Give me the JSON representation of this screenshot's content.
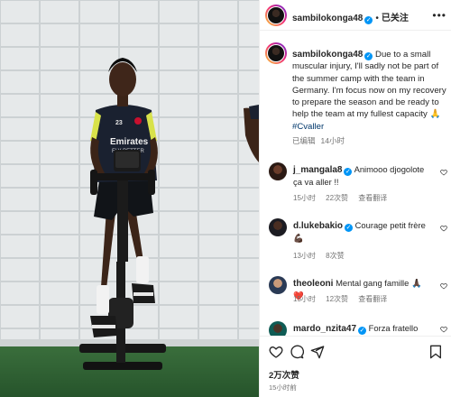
{
  "post": {
    "username": "sambilokonga48",
    "follow_sep": "•",
    "follow_label": "已关注",
    "more_label": "•••"
  },
  "caption": {
    "username": "sambilokonga48",
    "text": "Due to a small muscular injury, I'll sadly not be part of the summer camp with the team in Germany. I'm focus now on my recovery to prepare the season and be ready to help the team at my fullest capacity",
    "emoji": "🙏",
    "hashtag": "#Cvaller",
    "edited": "已编辑",
    "time": "14小时"
  },
  "comments": [
    {
      "username": "j_mangala8",
      "text": "Animooo djogolote ça va aller !!",
      "time": "15小时",
      "likes": "22次赞",
      "translate": "查看翻译"
    },
    {
      "username": "d.lukebakio",
      "text": "Courage petit frère",
      "emoji": "💪🏿",
      "time": "13小时",
      "likes": "8次赞"
    },
    {
      "username": "theoleoni",
      "text": "Mental gang famille 🙏🏿❤️",
      "time": "15小时",
      "likes": "12次赞",
      "translate": "查看翻译"
    },
    {
      "username": "mardo_nzita47",
      "text": "Forza fratello"
    }
  ],
  "stats": {
    "likes": "2万次赞",
    "ago": "15小时前"
  },
  "photo": {
    "shirt_text": "Emirates",
    "shirt_text2": "FLY BETTER",
    "number": "23"
  },
  "colors": {
    "link": "#00376b",
    "verified": "#0095f6",
    "secondary": "#737373"
  }
}
